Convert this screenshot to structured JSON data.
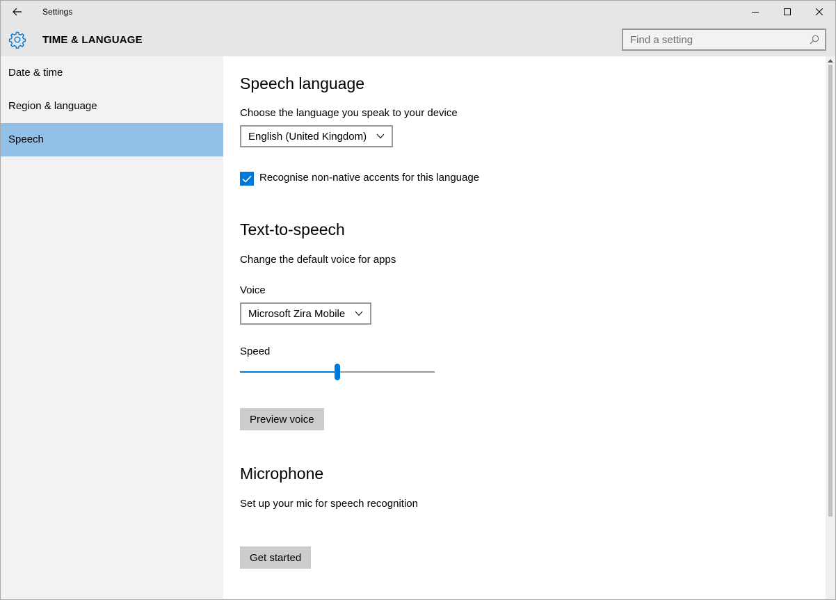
{
  "window": {
    "title": "Settings"
  },
  "header": {
    "section_title": "TIME & LANGUAGE",
    "search_placeholder": "Find a setting"
  },
  "sidebar": {
    "items": [
      {
        "label": "Date & time",
        "active": false
      },
      {
        "label": "Region & language",
        "active": false
      },
      {
        "label": "Speech",
        "active": true
      }
    ]
  },
  "speech_language": {
    "heading": "Speech language",
    "description": "Choose the language you speak to your device",
    "selected_language": "English (United Kingdom)",
    "accent_checkbox_label": "Recognise non-native accents for this language",
    "accent_checked": true
  },
  "tts": {
    "heading": "Text-to-speech",
    "description": "Change the default voice for apps",
    "voice_label": "Voice",
    "selected_voice": "Microsoft Zira Mobile",
    "speed_label": "Speed",
    "speed_value": 0.5,
    "preview_button": "Preview voice"
  },
  "microphone": {
    "heading": "Microphone",
    "description": "Set up your mic for speech recognition",
    "get_started_button": "Get started"
  },
  "colors": {
    "accent": "#0078d7",
    "selected_nav": "#93c0e7",
    "chrome": "#e6e6e6",
    "sidebar": "#f2f2f2",
    "button": "#cccccc"
  }
}
